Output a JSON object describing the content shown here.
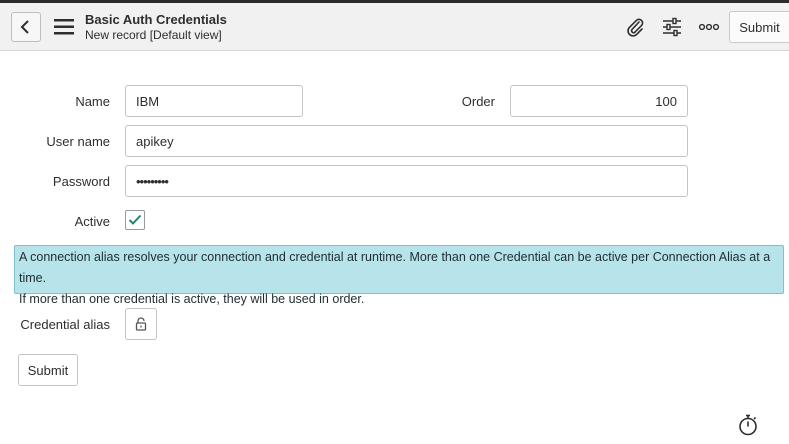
{
  "header": {
    "title": "Basic Auth Credentials",
    "subtitle": "New record [Default view]",
    "submit_label": "Submit",
    "icons": [
      "back-icon",
      "hamburger-menu-icon",
      "paperclip-icon",
      "sliders-icon",
      "more-options-icon"
    ]
  },
  "form": {
    "name": {
      "label": "Name",
      "value": "IBM"
    },
    "order": {
      "label": "Order",
      "value": "100"
    },
    "username": {
      "label": "User name",
      "value": "apikey"
    },
    "password": {
      "label": "Password",
      "value": "•••••••••"
    },
    "active": {
      "label": "Active",
      "checked": true
    },
    "credential_alias": {
      "label": "Credential alias",
      "icon": "lock-icon"
    },
    "submit_label": "Submit"
  },
  "info_message": {
    "line1": "A connection alias resolves your connection and credential at runtime. More than one Credential can be active per Connection Alias at a time.",
    "line2": "If more than one credential is active, they will be used in order."
  },
  "footer": {
    "icon": "stopwatch-icon"
  },
  "colors": {
    "header_bg": "#f1f1f1",
    "info_bg": "#b7e3ea",
    "info_border": "#7cc1cc",
    "check_color": "#1f8476"
  }
}
